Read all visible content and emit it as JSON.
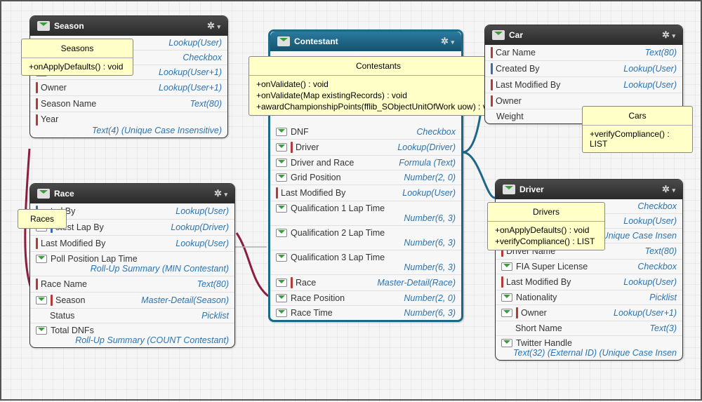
{
  "entities": {
    "season": {
      "title": "Season",
      "fields": [
        {
          "name": "",
          "type": "Lookup(User)",
          "icon": "mail"
        },
        {
          "name": "",
          "type": "Checkbox",
          "icon": "mail"
        },
        {
          "name": "",
          "type": "Lookup(User+1)",
          "icon": "mail"
        },
        {
          "name": "Owner",
          "type": "Lookup(User+1)",
          "bar": "red"
        },
        {
          "name": "Season Name",
          "type": "Text(80)",
          "bar": "red"
        },
        {
          "name": "Year",
          "type": "Text(4) (Unique Case Insensitive)",
          "bar": "red"
        }
      ]
    },
    "race": {
      "title": "Race",
      "fields": [
        {
          "name": "eated By",
          "type": "Lookup(User)",
          "bar": "blue"
        },
        {
          "name": "stest Lap By",
          "type": "Lookup(Driver)",
          "icon": "mail",
          "bar": "blue"
        },
        {
          "name": "Last Modified By",
          "type": "Lookup(User)",
          "bar": "red"
        },
        {
          "name": "Poll Position Lap Time",
          "type": "Roll-Up Summary (MIN Contestant)",
          "icon": "mail"
        },
        {
          "name": "Race Name",
          "type": "Text(80)",
          "bar": "red"
        },
        {
          "name": "Season",
          "type": "Master-Detail(Season)",
          "icon": "mail",
          "bar": "red"
        },
        {
          "name": "Status",
          "type": "Picklist"
        },
        {
          "name": "Total DNFs",
          "type": "Roll-Up Summary (COUNT Contestant)",
          "icon": "mail"
        }
      ]
    },
    "contestant": {
      "title": "Contestant",
      "fields": [
        {
          "name": "DNF",
          "type": "Checkbox",
          "icon": "mail"
        },
        {
          "name": "Driver",
          "type": "Lookup(Driver)",
          "icon": "mail",
          "bar": "red"
        },
        {
          "name": "Driver and Race",
          "type": "Formula (Text)",
          "icon": "mail"
        },
        {
          "name": "Grid Position",
          "type": "Number(2, 0)",
          "icon": "mail"
        },
        {
          "name": "Last Modified By",
          "type": "Lookup(User)",
          "bar": "red"
        },
        {
          "name": "Qualification 1 Lap Time",
          "type": "Number(6, 3)",
          "icon": "mail"
        },
        {
          "name": "Qualification 2 Lap Time",
          "type": "Number(6, 3)",
          "icon": "mail"
        },
        {
          "name": "Qualification 3 Lap Time",
          "type": "Number(6, 3)",
          "icon": "mail"
        },
        {
          "name": "Race",
          "type": "Master-Detail(Race)",
          "icon": "mail",
          "bar": "red"
        },
        {
          "name": "Race Position",
          "type": "Number(2, 0)",
          "icon": "mail"
        },
        {
          "name": "Race Time",
          "type": "Number(6, 3)",
          "icon": "mail"
        }
      ]
    },
    "car": {
      "title": "Car",
      "fields": [
        {
          "name": "Car Name",
          "type": "Text(80)",
          "bar": "red"
        },
        {
          "name": "Created By",
          "type": "Lookup(User)",
          "bar": "blue"
        },
        {
          "name": "Last Modified By",
          "type": "Lookup(User)",
          "bar": "red"
        },
        {
          "name": "Owner",
          "type": "",
          "bar": "red"
        },
        {
          "name": "Weight",
          "type": ""
        }
      ]
    },
    "driver": {
      "title": "Driver",
      "fields": [
        {
          "name": "",
          "type": "Checkbox",
          "icon": "mail"
        },
        {
          "name": "",
          "type": "Lookup(User)"
        },
        {
          "name": "",
          "type": "(Unique Case Insen",
          "icon": "mail"
        },
        {
          "name": "Driver Name",
          "type": "Text(80)",
          "bar": "red"
        },
        {
          "name": "FIA Super License",
          "type": "Checkbox",
          "icon": "mail"
        },
        {
          "name": "Last Modified By",
          "type": "Lookup(User)",
          "bar": "red"
        },
        {
          "name": "Nationality",
          "type": "Picklist",
          "icon": "mail"
        },
        {
          "name": "Owner",
          "type": "Lookup(User+1)",
          "icon": "mail",
          "bar": "red"
        },
        {
          "name": "Short Name",
          "type": "Text(3)"
        },
        {
          "name": "Twitter Handle",
          "type": "Text(32) (External ID) (Unique Case Insen",
          "icon": "mail"
        }
      ]
    }
  },
  "popups": {
    "seasons": {
      "title": "Seasons",
      "lines": [
        "+onApplyDefaults() : void"
      ]
    },
    "races": {
      "title": "Races",
      "lines": []
    },
    "contestants": {
      "title": "Contestants",
      "lines": [
        "+onValidate() : void",
        "+onValidate(Map existingRecords) : void",
        "+awardChampionshipPoints(fflib_SObjectUnitOfWork uow) : void"
      ]
    },
    "cars": {
      "title": "Cars",
      "lines": [
        "+verifyCompliance() : LIST"
      ]
    },
    "drivers": {
      "title": "Drivers",
      "lines": [
        "+onApplyDefaults() : void",
        "+verifyCompliance() : LIST"
      ]
    }
  }
}
